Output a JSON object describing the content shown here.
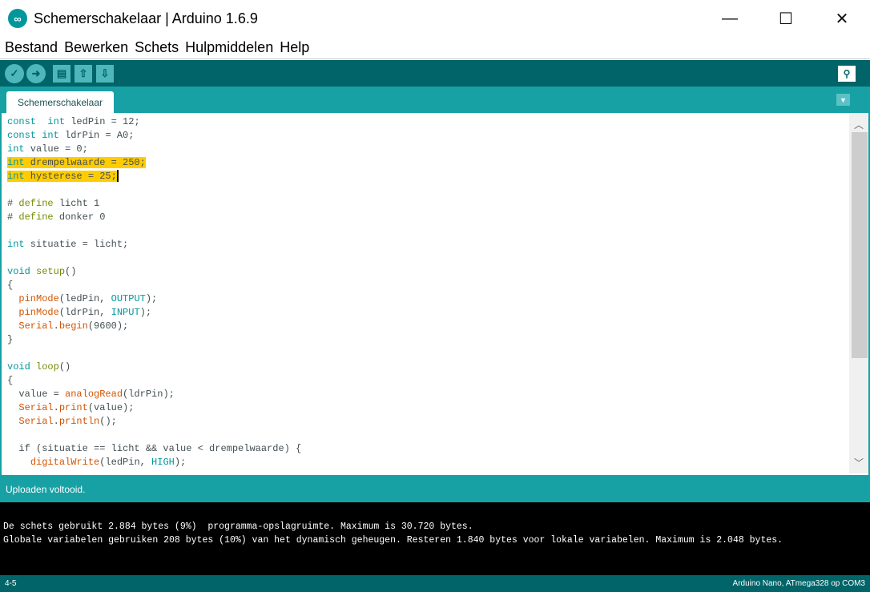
{
  "window": {
    "title": "Schemerschakelaar | Arduino 1.6.9",
    "minimize": "—",
    "maximize": "☐",
    "close": "✕"
  },
  "menu": [
    "Bestand",
    "Bewerken",
    "Schets",
    "Hulpmiddelen",
    "Help"
  ],
  "toolbar": {
    "verify": "✓",
    "upload": "➜",
    "new": "▤",
    "open": "⇧",
    "save": "⇩",
    "serial_monitor": "⚲"
  },
  "tab": {
    "label": "Schemerschakelaar",
    "menu": "▼"
  },
  "code": [
    [
      [
        "kw",
        "const"
      ],
      [
        "",
        "  "
      ],
      [
        "kw",
        "int"
      ],
      [
        "",
        " ledPin = 12;"
      ]
    ],
    [
      [
        "kw",
        "const"
      ],
      [
        "",
        " "
      ],
      [
        "kw",
        "int"
      ],
      [
        "",
        " ldrPin = A0;"
      ]
    ],
    [
      [
        "kw",
        "int"
      ],
      [
        "",
        " value = 0;"
      ]
    ],
    {
      "hl": true,
      "t": [
        [
          "kw",
          "int"
        ],
        [
          "",
          " drempelwaarde = 250;"
        ]
      ]
    },
    {
      "hl": true,
      "caret": true,
      "t": [
        [
          "kw",
          "int"
        ],
        [
          "",
          " hysterese = 25;"
        ]
      ]
    },
    [],
    [
      [
        "",
        "# "
      ],
      [
        "pp",
        "define"
      ],
      [
        "",
        " licht 1"
      ]
    ],
    [
      [
        "",
        "# "
      ],
      [
        "pp",
        "define"
      ],
      [
        "",
        " donker 0"
      ]
    ],
    [],
    [
      [
        "kw",
        "int"
      ],
      [
        "",
        " situatie = licht;"
      ]
    ],
    [],
    [
      [
        "kw",
        "void"
      ],
      [
        "",
        " "
      ],
      [
        "pp",
        "setup"
      ],
      [
        "",
        "()"
      ]
    ],
    [
      [
        "",
        "{"
      ]
    ],
    [
      [
        "",
        "  "
      ],
      [
        "fn",
        "pinMode"
      ],
      [
        "",
        "(ledPin, "
      ],
      [
        "cst",
        "OUTPUT"
      ],
      [
        "",
        ");"
      ]
    ],
    [
      [
        "",
        "  "
      ],
      [
        "fn",
        "pinMode"
      ],
      [
        "",
        "(ldrPin, "
      ],
      [
        "cst",
        "INPUT"
      ],
      [
        "",
        ");"
      ]
    ],
    [
      [
        "",
        "  "
      ],
      [
        "fn",
        "Serial"
      ],
      [
        "",
        "."
      ],
      [
        "fn",
        "begin"
      ],
      [
        "",
        "(9600);"
      ]
    ],
    [
      [
        "",
        "}"
      ]
    ],
    [],
    [
      [
        "kw",
        "void"
      ],
      [
        "",
        " "
      ],
      [
        "pp",
        "loop"
      ],
      [
        "",
        "()"
      ]
    ],
    [
      [
        "",
        "{"
      ]
    ],
    [
      [
        "",
        "  value = "
      ],
      [
        "fn",
        "analogRead"
      ],
      [
        "",
        "(ldrPin);"
      ]
    ],
    [
      [
        "",
        "  "
      ],
      [
        "fn",
        "Serial"
      ],
      [
        "",
        "."
      ],
      [
        "fn",
        "print"
      ],
      [
        "",
        "(value);"
      ]
    ],
    [
      [
        "",
        "  "
      ],
      [
        "fn",
        "Serial"
      ],
      [
        "",
        "."
      ],
      [
        "fn",
        "println"
      ],
      [
        "",
        "();"
      ]
    ],
    [],
    [
      [
        "",
        "  if (situatie == licht && value < drempelwaarde) {"
      ]
    ],
    [
      [
        "",
        "    "
      ],
      [
        "fn",
        "digitalWrite"
      ],
      [
        "",
        "(ledPin, "
      ],
      [
        "cst",
        "HIGH"
      ],
      [
        "",
        ");"
      ]
    ]
  ],
  "status": "Uploaden voltooid.",
  "console": [
    "De schets gebruikt 2.884 bytes (9%)  programma-opslagruimte. Maximum is 30.720 bytes.",
    "Globale variabelen gebruiken 208 bytes (10%) van het dynamisch geheugen. Resteren 1.840 bytes voor lokale variabelen. Maximum is 2.048 bytes."
  ],
  "footer": {
    "line": "4-5",
    "board": "Arduino Nano, ATmega328 op COM3"
  }
}
